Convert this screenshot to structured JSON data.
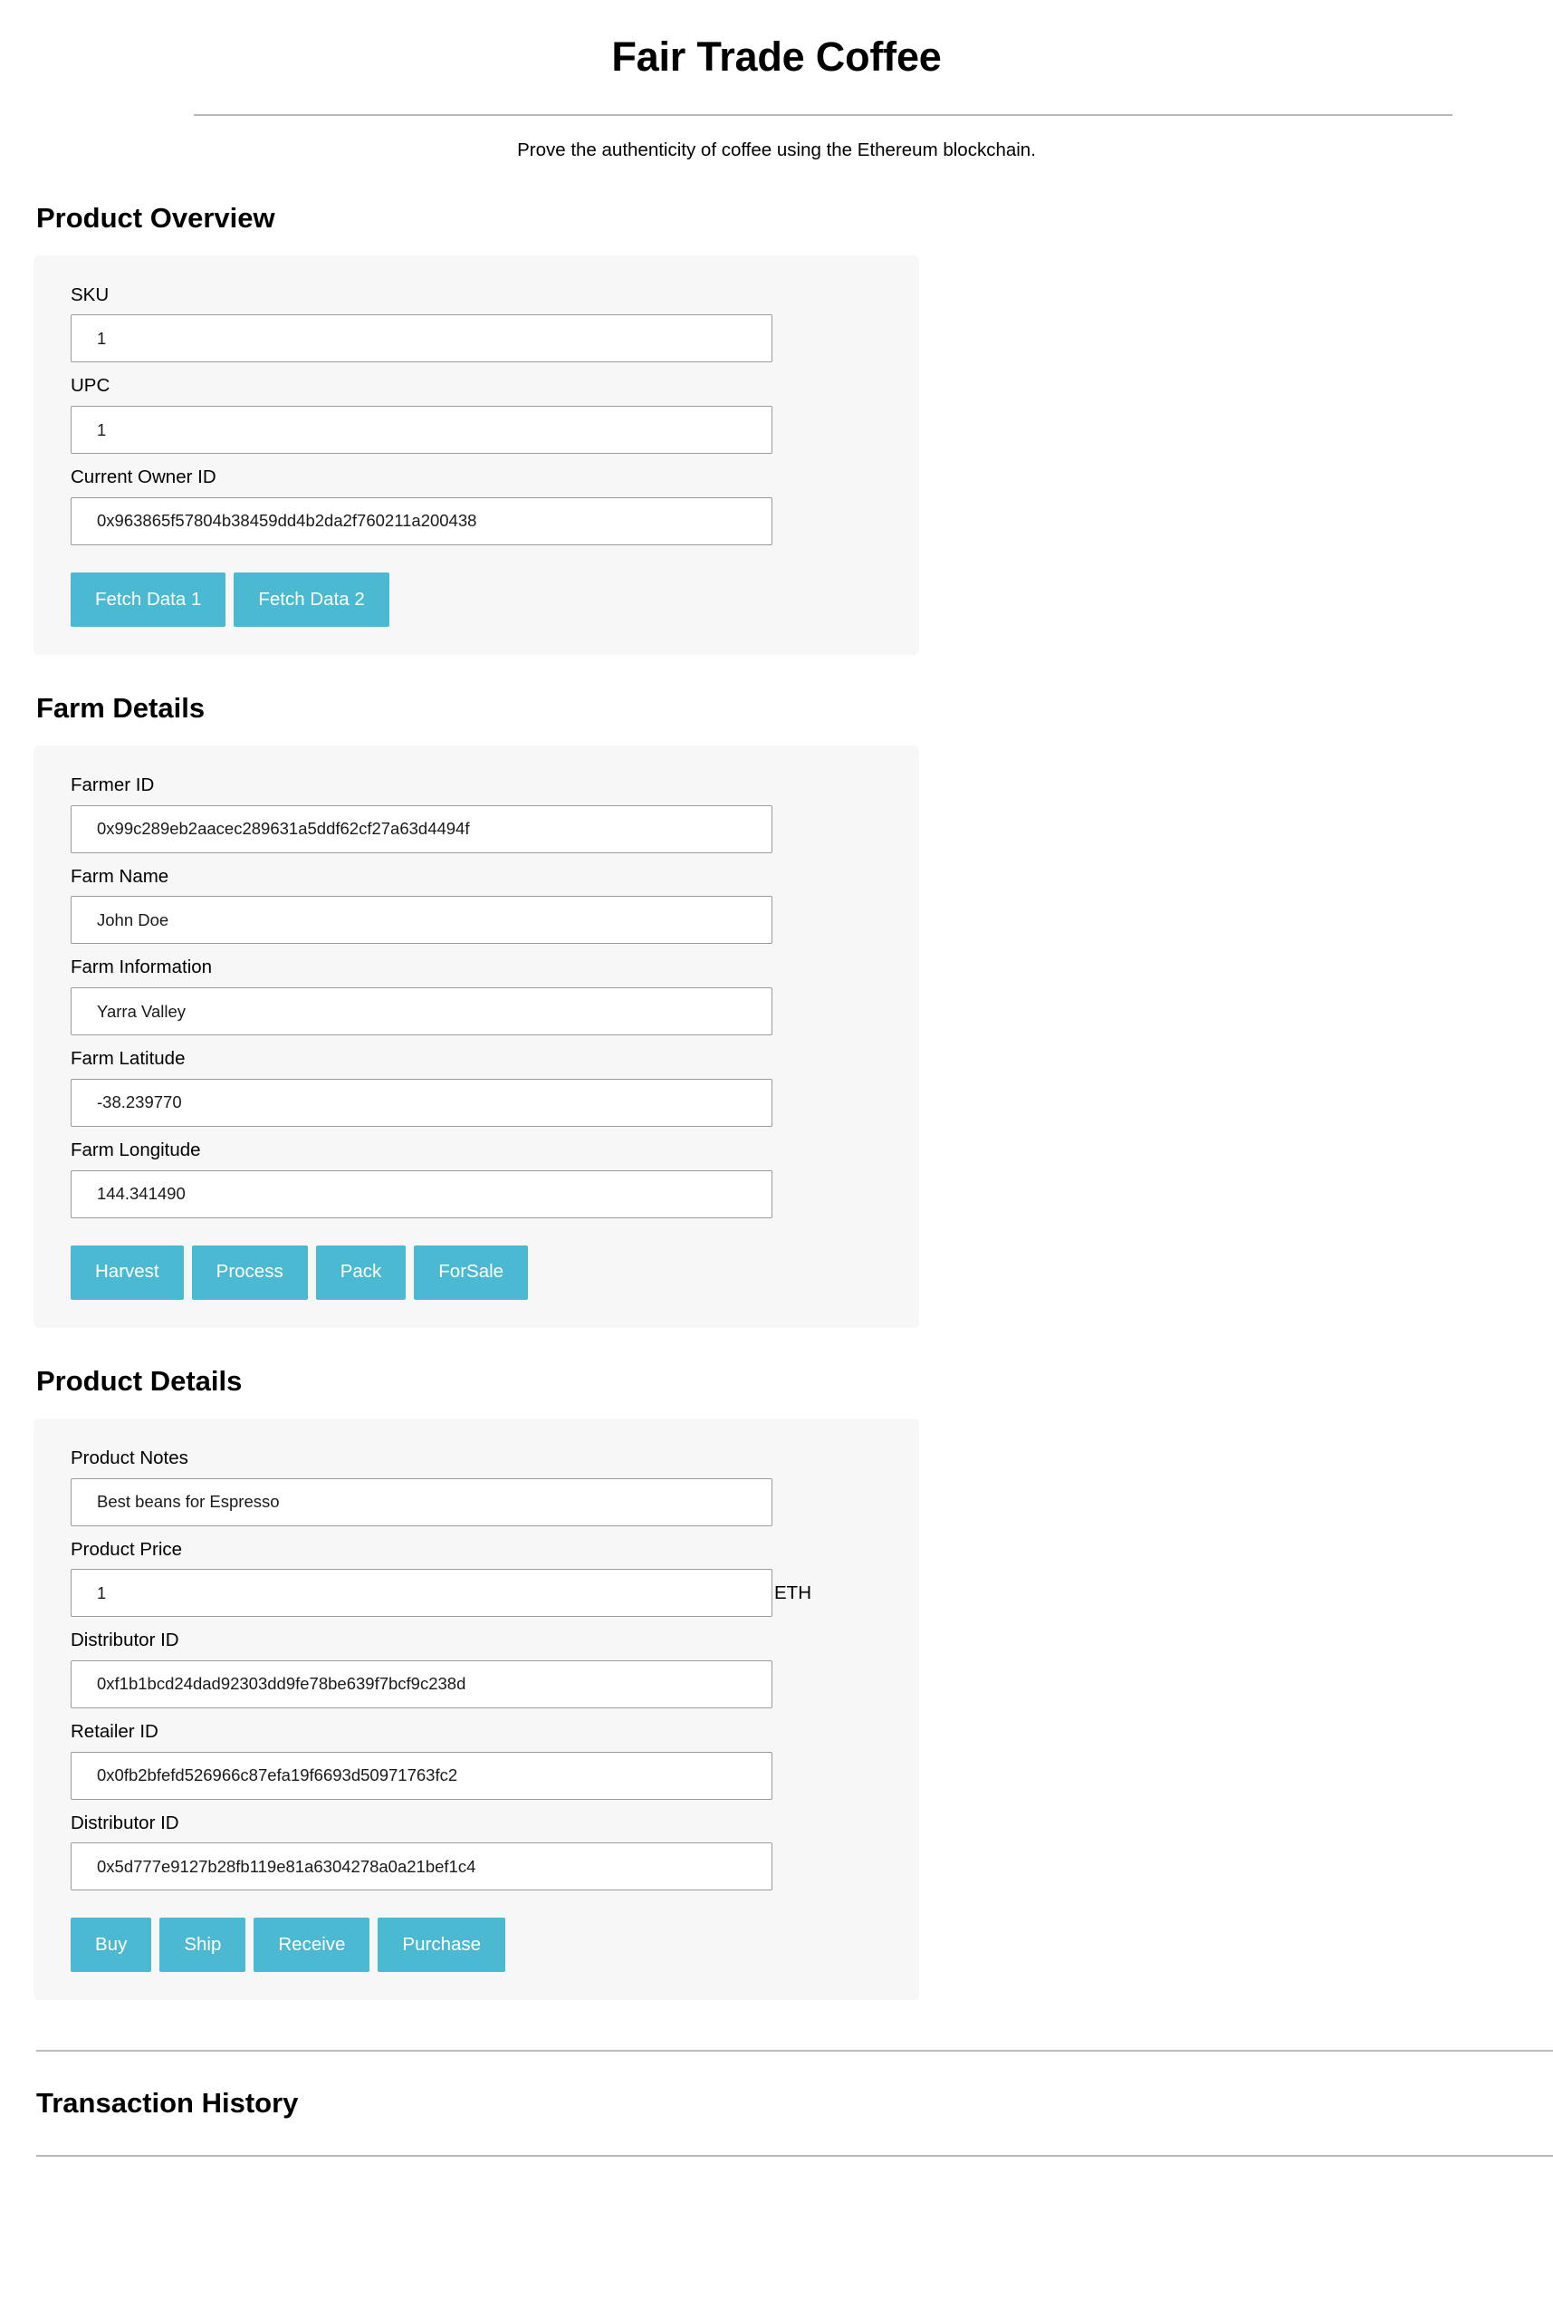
{
  "header": {
    "title": "Fair Trade Coffee",
    "lead": "Prove the authenticity of coffee using the Ethereum blockchain."
  },
  "sections": {
    "overview": {
      "heading": "Product Overview",
      "fields": [
        {
          "label": "SKU",
          "value": "1",
          "placeholder": "SKU"
        },
        {
          "label": "UPC",
          "value": "1",
          "placeholder": "UPC"
        },
        {
          "label": "Current Owner ID",
          "value": "0x963865f57804b38459dd4b2da2f760211a200438",
          "placeholder": "Current Owner ID"
        }
      ],
      "buttons": [
        {
          "label": "Fetch Data 1"
        },
        {
          "label": "Fetch Data 2"
        }
      ]
    },
    "farm": {
      "heading": "Farm Details",
      "fields": [
        {
          "label": "Farmer ID",
          "value": "0x99c289eb2aacec289631a5ddf62cf27a63d4494f",
          "placeholder": "Farmer ID"
        },
        {
          "label": "Farm Name",
          "value": "John Doe",
          "placeholder": "Farm Name"
        },
        {
          "label": "Farm Information",
          "value": "Yarra Valley",
          "placeholder": "Farm Information"
        },
        {
          "label": "Farm Latitude",
          "value": "-38.239770",
          "placeholder": "Farm Latitude"
        },
        {
          "label": "Farm Longitude",
          "value": "144.341490",
          "placeholder": "Farm Longitude"
        }
      ],
      "buttons": [
        {
          "label": "Harvest"
        },
        {
          "label": "Process"
        },
        {
          "label": "Pack"
        },
        {
          "label": "ForSale"
        }
      ]
    },
    "product": {
      "heading": "Product Details",
      "fields": [
        {
          "label": "Product Notes",
          "value": "Best beans for Espresso",
          "placeholder": "Product Notes"
        },
        {
          "label": "Product Price",
          "value": "1",
          "placeholder": "Product Price",
          "suffix": "ETH"
        },
        {
          "label": "Distributor ID",
          "value": "0xf1b1bcd24dad92303dd9fe78be639f7bcf9c238d",
          "placeholder": "Distributor ID"
        },
        {
          "label": "Retailer ID",
          "value": "0x0fb2bfefd526966c87efa19f6693d50971763fc2",
          "placeholder": "Retailer ID"
        },
        {
          "label": "Distributor ID",
          "value": "0x5d777e9127b28fb119e81a6304278a0a21bef1c4",
          "placeholder": "Distributor ID"
        }
      ],
      "buttons": [
        {
          "label": "Buy"
        },
        {
          "label": "Ship"
        },
        {
          "label": "Receive"
        },
        {
          "label": "Purchase"
        }
      ]
    }
  },
  "ledger": {
    "heading": "Transaction History"
  },
  "colors": {
    "accent": "#4ab9d1",
    "card_background": "#f7f7f7",
    "input_border": "#9b9b9b",
    "rule": "#b8b8b8",
    "text": "#000000"
  }
}
